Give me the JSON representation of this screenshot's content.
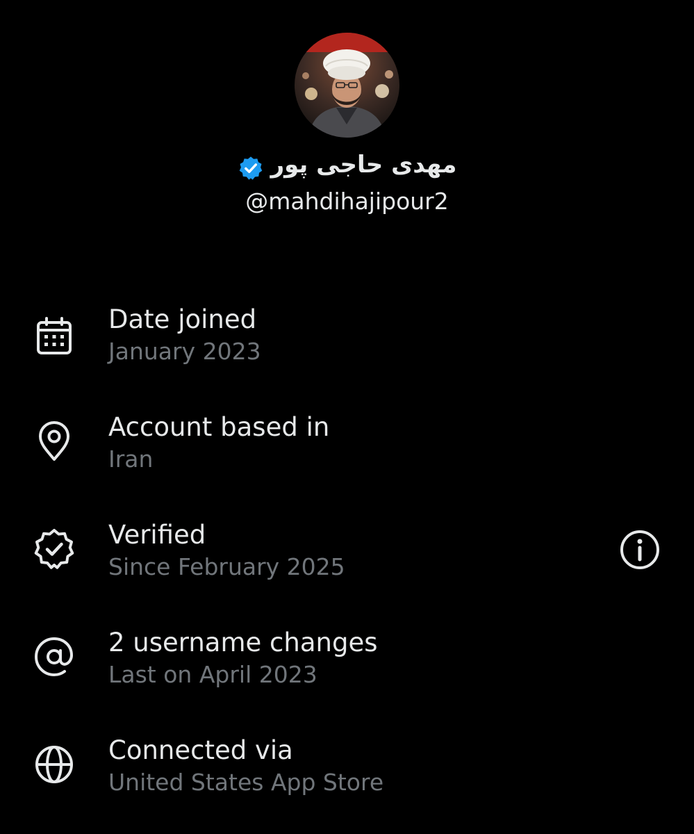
{
  "profile": {
    "display_name": "مهدی حاجی پور",
    "handle": "@mahdihajipour2",
    "verified_badge_color": "#1d9bf0",
    "avatar_icon": "profile-photo"
  },
  "details": [
    {
      "icon": "calendar-icon",
      "title": "Date joined",
      "subtitle": "January 2023"
    },
    {
      "icon": "location-pin-icon",
      "title": "Account based in",
      "subtitle": "Iran"
    },
    {
      "icon": "verified-badge-icon",
      "title": "Verified",
      "subtitle": "Since February 2025",
      "action_icon": "info-icon"
    },
    {
      "icon": "at-sign-icon",
      "title": "2 username changes",
      "subtitle": "Last on April 2023"
    },
    {
      "icon": "globe-icon",
      "title": "Connected via",
      "subtitle": "United States App Store"
    }
  ],
  "colors": {
    "background": "#000000",
    "primary_text": "#e7e9ea",
    "secondary_text": "#71767b",
    "icon": "#e7e9ea",
    "accent": "#1d9bf0"
  }
}
